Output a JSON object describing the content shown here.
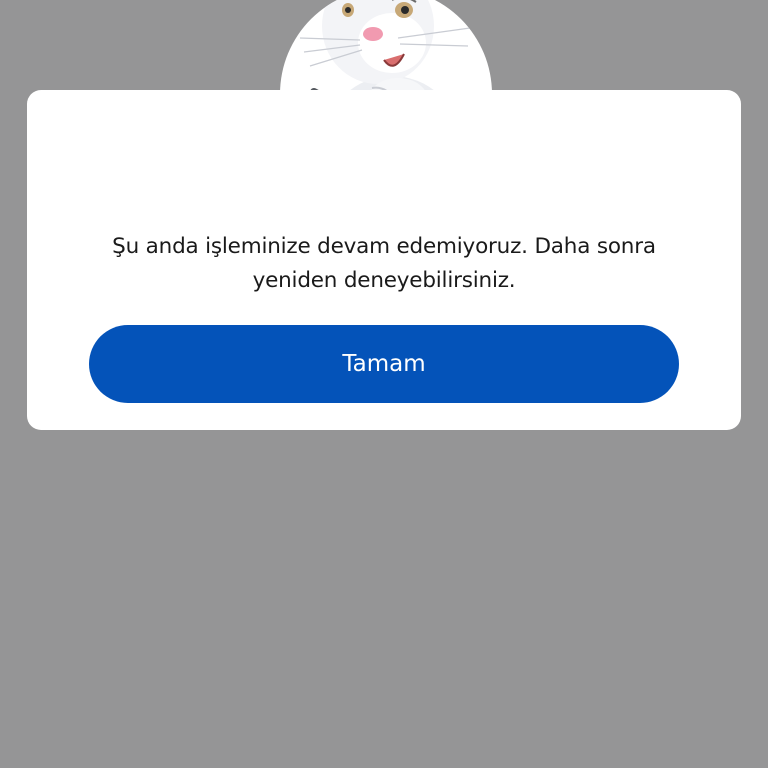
{
  "colors": {
    "overlay": "#959596",
    "dialog_background": "#ffffff",
    "primary_button": "#0453b9",
    "text": "#1a1a1a"
  },
  "dialog": {
    "avatar_icon": "bunny-mascot-icon",
    "message_line_1": "Şu anda işleminize devam edemiyoruz. Daha sonra",
    "message_line_2": "yeniden deneyebilirsiniz.",
    "ok_button_label": "Tamam"
  }
}
